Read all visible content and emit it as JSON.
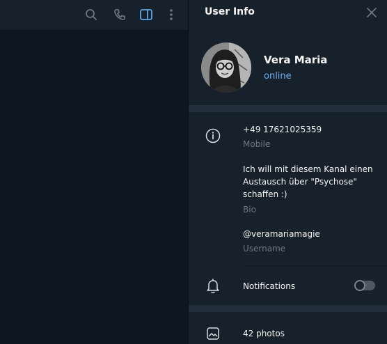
{
  "header_icons": [
    "search-icon",
    "phone-icon",
    "sidebar-toggle-icon",
    "more-vertical-icon"
  ],
  "panel": {
    "title": "User Info",
    "close_icon": "close-icon"
  },
  "profile": {
    "name": "Vera Maria",
    "status": "online"
  },
  "info": {
    "phone": "+49 17621025359",
    "phone_label": "Mobile",
    "bio": "Ich will mit diesem Kanal einen\nAustausch über \"Psychose\"\nschaffen :)",
    "bio_label": "Bio",
    "username": "@veramariamagie",
    "username_label": "Username"
  },
  "notifications": {
    "label": "Notifications",
    "enabled": false
  },
  "media": {
    "photos_label": "42 photos"
  },
  "colors": {
    "accent": "#6ab2f2",
    "active_icon": "#5fa8e8",
    "background": "#17212b",
    "chat_background": "#0e1621",
    "separator": "#232e3c"
  }
}
